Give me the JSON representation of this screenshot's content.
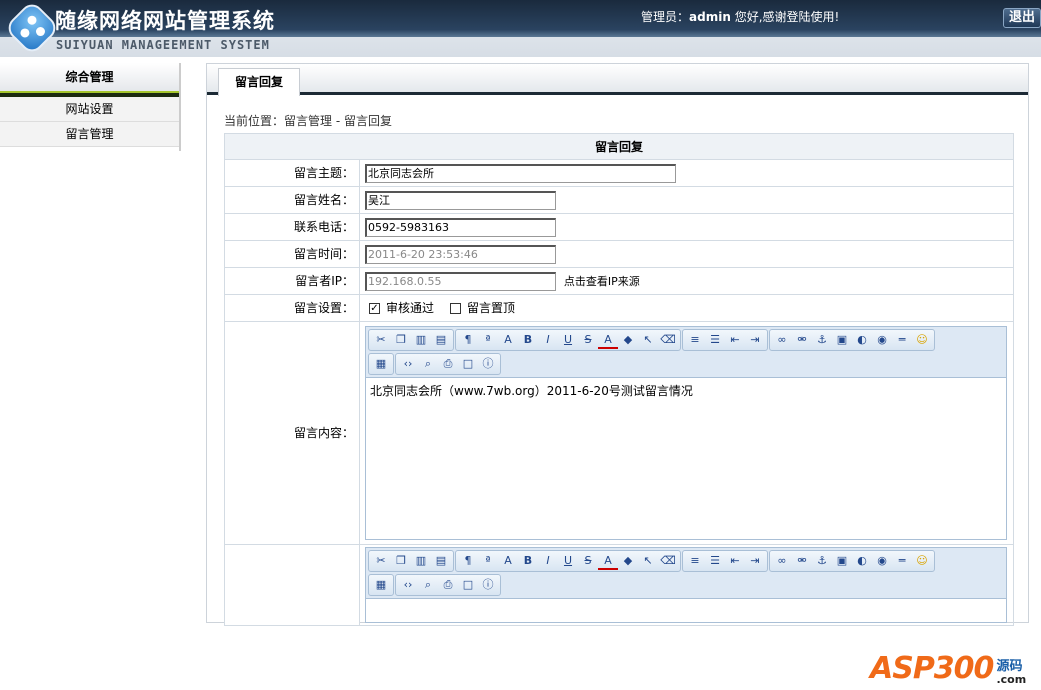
{
  "header": {
    "title": "随缘网络网站管理系统",
    "subtitle": "SUIYUAN MANAGEEMENT SYSTEM",
    "welcome_prefix": "管理员：",
    "username": "admin",
    "welcome_suffix": " 您好,感谢登陆使用!",
    "logout": "退出"
  },
  "sidebar": {
    "heading": "综合管理",
    "items": [
      {
        "label": "网站设置"
      },
      {
        "label": "留言管理"
      }
    ]
  },
  "main": {
    "tab": "留言回复",
    "breadcrumb": "当前位置：留言管理 - 留言回复",
    "form": {
      "heading": "留言回复",
      "subject": {
        "label": "留言主题：",
        "value": "北京同志会所"
      },
      "name": {
        "label": "留言姓名：",
        "value": "吴江"
      },
      "phone": {
        "label": "联系电话：",
        "value": "0592-5983163"
      },
      "time": {
        "label": "留言时间：",
        "value": "2011-6-20 23:53:46"
      },
      "ip": {
        "label": "留言者IP：",
        "value": "192.168.0.55",
        "lookup": "点击查看IP来源"
      },
      "settings": {
        "label": "留言设置：",
        "approved": {
          "label": "审核通过",
          "checked": true
        },
        "pinned": {
          "label": "留言置顶",
          "checked": false
        }
      },
      "content": {
        "label": "留言内容：",
        "text": "北京同志会所（www.7wb.org）2011-6-20号测试留言情况"
      },
      "toolbar_groups": [
        [
          "cut",
          "copy",
          "paste",
          "paste-text"
        ],
        [
          "paragraph",
          "font-name",
          "font-size",
          "bold",
          "italic",
          "underline",
          "strikethrough",
          "font-color",
          "highlight",
          "select",
          "eraser"
        ],
        [
          "align",
          "list",
          "outdent",
          "indent"
        ],
        [
          "link",
          "unlink",
          "anchor",
          "image",
          "flash",
          "media",
          "horizontal-rule",
          "emoticon"
        ],
        [
          "table"
        ],
        [
          "source",
          "preview",
          "print",
          "fullscreen",
          "about"
        ]
      ]
    }
  },
  "footer": {
    "brand": "ASP300",
    "brand_cn": "源码",
    "brand_domain": ".com"
  }
}
